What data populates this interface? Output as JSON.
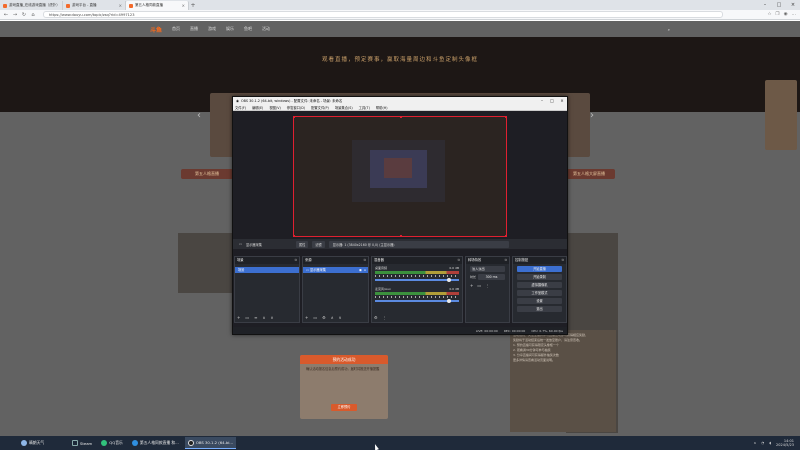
{
  "browser": {
    "tabs": [
      {
        "label": "游戏直播_在线游戏直播（虎扑）",
        "active": false
      },
      {
        "label": "游戏平台 - 直播",
        "active": false
      },
      {
        "label": "第五人格同款直播",
        "active": true
      }
    ],
    "url": "https://www.douyu.com/topic/zsq?rid=4997123"
  },
  "site": {
    "logo": "斗鱼",
    "nav": [
      "首页",
      "直播",
      "游戏",
      "娱乐",
      "鱼吧",
      "活动"
    ],
    "slogan": "观看直播，预定赛事，赢取海量周边和斗鱼定制头像框",
    "left_button": "第五人格直播",
    "right_button": "第五人格大屏直播",
    "promo_title": "预约活动成功",
    "promo_body": "确认活动报名信息后预约成功，届时将推送开播提醒",
    "promo_button": "立即预约",
    "article_rows": [
      "活动规则：关注主播并参与直播互动即可获得相应奖励，",
      "奖励将于活动结束后统一发放至账户，请注意查收。",
      "1. 预约直播可获得限定头像框一个",
      "2. 观看满30分钟可参与抽奖",
      "3. 分享直播间可获得额外抽奖次数",
      "更多详情请查看活动页面说明。"
    ]
  },
  "obs": {
    "title": "OBS 30.1.2 (64-bit, windows) - 配置文件: 未命名 - 场景: 未命名",
    "menu": [
      "文件(F)",
      "编辑(E)",
      "视图(V)",
      "停靠窗口(D)",
      "配置文件(P)",
      "场景集合(S)",
      "工具(T)",
      "帮助(H)"
    ],
    "source_bar": {
      "source_name": "显示器采集",
      "properties_label": "属性",
      "filters_label": "滤镜",
      "display_field": "显示器: 1 (3840x2160 @ 0,0) (主显示器)"
    },
    "scenes": {
      "title": "场景",
      "items": [
        "场景"
      ]
    },
    "sources": {
      "title": "来源",
      "items": [
        "显示器采集"
      ]
    },
    "mixer": {
      "title": "混音器",
      "channels": [
        {
          "name": "桌面音频",
          "db": "0.0 dB"
        },
        {
          "name": "麦克风/Aux",
          "db": "0.0 dB"
        }
      ]
    },
    "transitions": {
      "title": "转场特效",
      "type": "淡入淡出",
      "duration_label": "时长",
      "duration": "300 ms"
    },
    "controls": {
      "title": "控制按钮",
      "buttons": [
        "开始直播",
        "开始录制",
        "虚拟摄像机",
        "工作室模式",
        "设置",
        "退出"
      ]
    },
    "status": {
      "live": "LIVE: 00:00:00",
      "rec": "REC: 00:00:00",
      "cpu": "CPU: 0.7%, 60.00 fps"
    }
  },
  "taskbar": {
    "weather": "晴朗天气",
    "items": [
      {
        "label": "Steam",
        "active": false
      },
      {
        "label": "QQ音乐",
        "active": false
      },
      {
        "label": "第五人格同款直播 和...",
        "active": false
      },
      {
        "label": "OBS 30.1.2 (64-bi...",
        "active": true
      }
    ],
    "time": "14:01",
    "date": "2024/5/23"
  },
  "colors": {
    "accent": "#ff6b1a",
    "obs_bg": "#1e1e24",
    "preview_border": "#e02030",
    "taskbar": "#1f2a3a"
  }
}
